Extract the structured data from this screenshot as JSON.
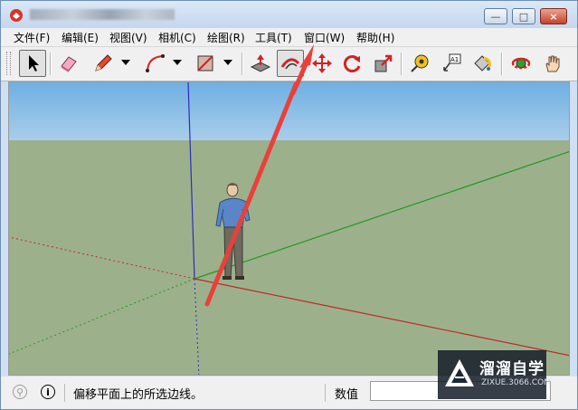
{
  "window": {
    "title": "",
    "controls": {
      "minimize": "—",
      "maximize": "□",
      "close": "×"
    }
  },
  "menu": [
    "文件(F)",
    "编辑(E)",
    "视图(V)",
    "相机(C)",
    "绘图(R)",
    "工具(T)",
    "窗口(W)",
    "帮助(H)"
  ],
  "toolbar": {
    "tools": [
      "select-icon",
      "eraser-icon",
      "pencil-line-icon",
      "arc-icon",
      "rectangle-icon",
      "push-pull-icon",
      "offset-icon",
      "move-icon",
      "rotate-icon",
      "scale-icon",
      "tape-measure-icon",
      "text-icon",
      "paint-bucket-icon",
      "orbit-icon",
      "pan-icon"
    ],
    "active_tool": "offset-icon",
    "text_tool_glyph": "A1"
  },
  "viewport": {
    "sky_color": "#a9cdea",
    "ground_color": "#9db08c",
    "axis_colors": {
      "red": "#c02828",
      "green": "#1f9a1f",
      "blue": "#2d2dbd"
    },
    "annotation_arrow_color": "#e8413a"
  },
  "status": {
    "hint": "偏移平面上的所选边线。",
    "measure_label": "数值",
    "measure_value": ""
  },
  "watermark": {
    "title": "溜溜自学",
    "url": "ZIXUE.3066.COM"
  }
}
